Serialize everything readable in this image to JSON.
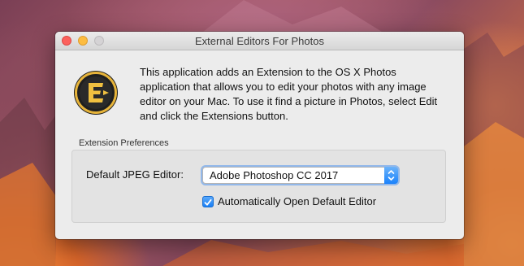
{
  "window": {
    "title": "External Editors For Photos"
  },
  "app_icon": "external-editors-logo",
  "description": "This application adds an Extension to the OS X Photos application that allows you to edit your photos with any image editor on your Mac. To use it find a picture in Photos, select Edit and click the Extensions button.",
  "preferences": {
    "section_label": "Extension Preferences",
    "default_editor_label": "Default JPEG Editor:",
    "default_editor_value": "Adobe Photoshop CC 2017",
    "auto_open_label": "Automatically Open Default Editor",
    "auto_open_checked": true
  },
  "colors": {
    "accent": "#1a82fb",
    "close": "#fc615d",
    "minimize": "#fdbc40",
    "zoom_disabled": "#d5d3d5"
  }
}
